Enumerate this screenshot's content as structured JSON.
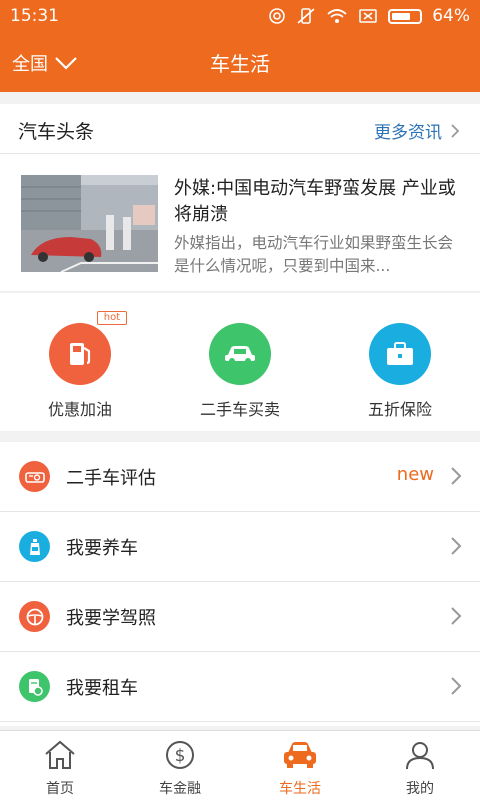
{
  "status_bar": {
    "time": "15:31",
    "battery": "64%"
  },
  "nav": {
    "region": "全国",
    "title": "车生活"
  },
  "news": {
    "section_title": "汽车头条",
    "more_label": "更多资讯",
    "article": {
      "title": "外媒:中国电动汽车野蛮发展 产业或将崩溃",
      "summary": "外媒指出，电动汽车行业如果野蛮生长会是什么情况呢，只要到中国来..."
    }
  },
  "services": [
    {
      "label": "优惠加油",
      "color": "#f0613d",
      "icon": "fuel-pump-icon",
      "badge": "hot"
    },
    {
      "label": "二手车买卖",
      "color": "#3ec46b",
      "icon": "car-icon"
    },
    {
      "label": "五折保险",
      "color": "#1aaee0",
      "icon": "briefcase-icon"
    }
  ],
  "menu": [
    {
      "label": "二手车评估",
      "badge": "new",
      "color": "#f0613d",
      "icon": "car-appraisal-icon"
    },
    {
      "label": "我要养车",
      "color": "#1aaee0",
      "icon": "oil-bottle-icon"
    },
    {
      "label": "我要学驾照",
      "color": "#f0613d",
      "icon": "steering-wheel-icon"
    },
    {
      "label": "我要租车",
      "color": "#3ec46b",
      "icon": "rental-icon"
    }
  ],
  "tabs": [
    {
      "label": "首页",
      "icon": "home-icon"
    },
    {
      "label": "车金融",
      "icon": "dollar-icon"
    },
    {
      "label": "车生活",
      "icon": "car-front-icon",
      "active": true
    },
    {
      "label": "我的",
      "icon": "user-icon"
    }
  ],
  "colors": {
    "brand": "#ee6a1e",
    "link": "#2b73b6"
  }
}
